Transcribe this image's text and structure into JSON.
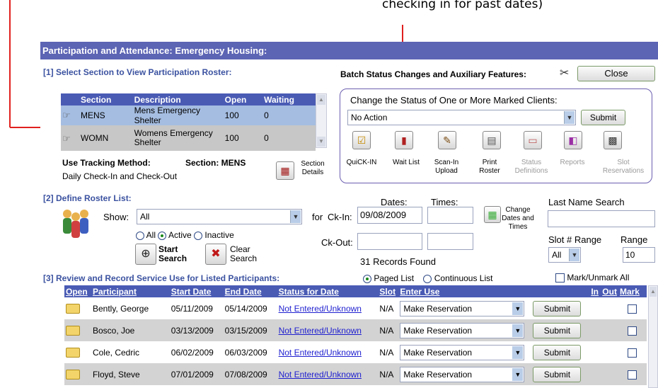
{
  "annotation": {
    "text": "checking in for past dates)"
  },
  "window": {
    "title": "Participation and Attendance: Emergency Housing:"
  },
  "section1": {
    "heading": "[1] Select Section to View Participation Roster:",
    "columns": [
      "Section",
      "Description",
      "Open",
      "Waiting"
    ],
    "rows": [
      {
        "section": "MENS",
        "description": "Mens Emergency Shelter",
        "open": "100",
        "waiting": "0"
      },
      {
        "section": "WOMN",
        "description": "Womens Emergency Shelter",
        "open": "100",
        "waiting": "0"
      }
    ],
    "tracking_label": "Use Tracking Method:",
    "section_label": "Section: MENS",
    "tracking_value": "Daily Check-In and Check-Out",
    "section_details": "Section Details"
  },
  "batch": {
    "heading": "Batch Status Changes and Auxiliary Features:",
    "close_label": "Close",
    "change_heading": "Change the Status of One or More Marked Clients:",
    "action_value": "No Action",
    "submit_label": "Submit",
    "tools": [
      {
        "label": "QuiCK-IN",
        "icon": "check-in-icon",
        "enabled": true
      },
      {
        "label": "Wait List",
        "icon": "wait-list-icon",
        "enabled": true
      },
      {
        "label": "Scan-In Upload",
        "icon": "scan-icon",
        "enabled": true
      },
      {
        "label": "Print Roster",
        "icon": "printer-icon",
        "enabled": true
      },
      {
        "label": "Status Definitions",
        "icon": "status-icon",
        "enabled": false
      },
      {
        "label": "Reports",
        "icon": "reports-icon",
        "enabled": false
      },
      {
        "label": "Slot Reservations",
        "icon": "slots-icon",
        "enabled": false
      }
    ]
  },
  "section2": {
    "heading": "[2] Define Roster List:",
    "show_label": "Show:",
    "show_value": "All",
    "for_label": "for",
    "radio_all": "All",
    "radio_active": "Active",
    "radio_inactive": "Inactive",
    "start_search": "Start Search",
    "clear_search": "Clear Search",
    "dates_label": "Dates:",
    "times_label": "Times:",
    "ck_in_label": "Ck-In:",
    "ck_in_value": "09/08/2009",
    "ck_out_label": "Ck-Out:",
    "change_dates": "Change Dates and Times",
    "records_found": "31 Records Found",
    "last_name_label": "Last Name Search",
    "slot_range_label": "Slot # Range",
    "slot_value": "All",
    "range_label": "Range",
    "range_value": "10"
  },
  "section3": {
    "heading": "[3] Review and Record Service Use for Listed Participants:",
    "paged_list": "Paged List",
    "continuous_list": "Continuous List",
    "mark_unmark": "Mark/Unmark All",
    "columns": [
      "Open",
      "Participant",
      "Start Date",
      "End Date",
      "Status for Date",
      "Slot",
      "Enter Use",
      "",
      "In",
      "Out",
      "Mark"
    ],
    "rows": [
      {
        "name": "Bently, George",
        "start": "05/11/2009",
        "end": "05/14/2009",
        "status": "Not Entered/Unknown",
        "slot": "N/A",
        "use": "Make Reservation",
        "submit": "Submit"
      },
      {
        "name": "Bosco, Joe",
        "start": "03/13/2009",
        "end": "03/15/2009",
        "status": "Not Entered/Unknown",
        "slot": "N/A",
        "use": "Make Reservation",
        "submit": "Submit"
      },
      {
        "name": "Cole, Cedric",
        "start": "06/02/2009",
        "end": "06/03/2009",
        "status": "Not Entered/Unknown",
        "slot": "N/A",
        "use": "Make Reservation",
        "submit": "Submit"
      },
      {
        "name": "Floyd, Steve",
        "start": "07/01/2009",
        "end": "07/08/2009",
        "status": "Not Entered/Unknown",
        "slot": "N/A",
        "use": "Make Reservation",
        "submit": "Submit"
      }
    ]
  },
  "colors": {
    "titlebar": "#5c64b4",
    "header": "#4a5bb4",
    "annotation_arrow": "#e0201e",
    "heading_text": "#3b52a0"
  }
}
